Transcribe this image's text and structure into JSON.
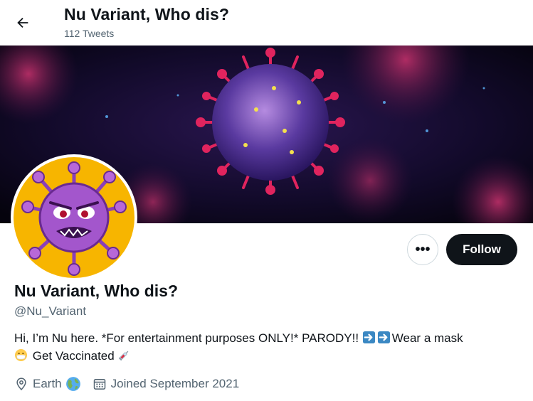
{
  "header": {
    "title": "Nu Variant, Who dis?",
    "tweet_count": "112 Tweets"
  },
  "profile": {
    "display_name": "Nu Variant, Who dis?",
    "handle": "@Nu_Variant",
    "bio": {
      "part1": "Hi, I’m Nu here. *For entertainment purposes ONLY!* PARODY!! ",
      "part2": "Wear a mask ",
      "part3": " Get Vaccinated ",
      "emojis": [
        "arrow-right-emoji",
        "arrow-right-emoji",
        "face-with-mask-emoji",
        "syringe-emoji"
      ]
    },
    "location": "Earth",
    "location_emoji": "globe-emoji",
    "joined": "Joined September 2021"
  },
  "actions": {
    "more_label": "•••",
    "follow_label": "Follow"
  },
  "colors": {
    "text": "#0f1419",
    "secondary_text": "#536471",
    "follow_bg": "#0f1419",
    "avatar_bg": "#f7b500",
    "virus_purple": "#8a3fb8",
    "banner_spike": "#e0245e"
  }
}
